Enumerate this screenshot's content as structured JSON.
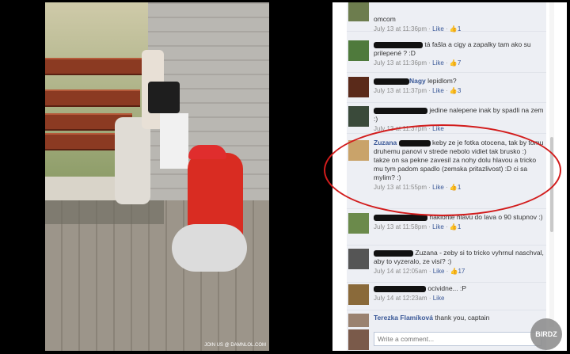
{
  "photo": {
    "watermark": "JOIN US @ DAMNLOL.COM"
  },
  "close_label": "×",
  "comments": [
    {
      "author": "",
      "text": "omcom",
      "time": "July 13 at 11:36pm",
      "like": "Like",
      "likes": "1"
    },
    {
      "author": "",
      "text": "tá fašla a cigy a zapalky tam ako su prilepené ? :D",
      "time": "July 13 at 11:36pm",
      "like": "Like",
      "likes": "7"
    },
    {
      "author": "Nagy",
      "text": "lepidlom?",
      "time": "July 13 at 11:37pm",
      "like": "Like",
      "likes": "3"
    },
    {
      "author": "",
      "text": "jedine nalepene inak by spadli na zem :)",
      "time": "July 13 at 11:37pm",
      "like": "Like",
      "likes": ""
    },
    {
      "author": "Zuzana",
      "text": "keby ze je fotka otocena, tak by tomu druhemu panovi v strede nebolo vidiet tak brusko :) takze on sa pekne zavesil za nohy dolu hlavou a tricko mu tym padom spadlo (zemska pritazlivost) :D ci sa mylim? :)",
      "time": "July 13 at 11:55pm",
      "like": "Like",
      "likes": "1"
    },
    {
      "author": "",
      "text": "naklonte hlavu do lava o 90 stupnov :)",
      "time": "July 13 at 11:58pm",
      "like": "Like",
      "likes": "1"
    },
    {
      "author": "",
      "text": "Zuzana - zeby si to tricko vyhrnul naschval, aby to vyzeralo, ze visí? :)",
      "time": "July 14 at 12:05am",
      "like": "Like",
      "likes": "17"
    },
    {
      "author": "",
      "text": "ocividne... :P",
      "time": "July 14 at 12:23am",
      "like": "Like",
      "likes": ""
    },
    {
      "author": "Terezka Flamíková",
      "text": "thank you, captain",
      "time": "",
      "like": "",
      "likes": ""
    }
  ],
  "write_placeholder": "Write a comment...",
  "birdz": "BIRDZ",
  "icons": {
    "like": "thumbs-up-icon",
    "close": "close-icon"
  }
}
